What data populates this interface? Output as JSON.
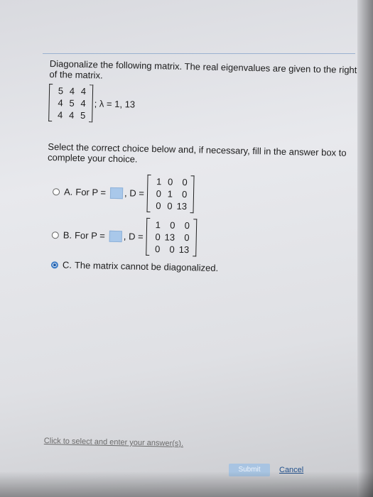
{
  "problem": {
    "text": "Diagonalize the following matrix. The real eigenvalues are given to the right of the matrix.",
    "matrix": [
      [
        "5",
        "4",
        "4"
      ],
      [
        "4",
        "5",
        "4"
      ],
      [
        "4",
        "4",
        "5"
      ]
    ],
    "eigen_text": "; λ = 1, 13"
  },
  "instruction": "Select the correct choice below and, if necessary, fill in the answer box to complete your choice.",
  "choices": [
    {
      "letter": "A.",
      "prefix": "For P =",
      "d_label": ", D =",
      "matrix": [
        [
          "1",
          "0",
          "0"
        ],
        [
          "0",
          "1",
          "0"
        ],
        [
          "0",
          "0",
          "13"
        ]
      ],
      "selected": false
    },
    {
      "letter": "B.",
      "prefix": "For P =",
      "d_label": ", D =",
      "matrix": [
        [
          "1",
          "0",
          "0"
        ],
        [
          "0",
          "13",
          "0"
        ],
        [
          "0",
          "0",
          "13"
        ]
      ],
      "selected": false
    },
    {
      "letter": "C.",
      "text": "The matrix cannot be diagonalized.",
      "selected": true
    }
  ],
  "hint": "Click to select and enter your answer(s).",
  "buttons": {
    "submit": "Submit",
    "cancel": "Cancel"
  },
  "colors": {
    "accent": "#1f5aa5",
    "answer_box": "#a9c8ea"
  }
}
